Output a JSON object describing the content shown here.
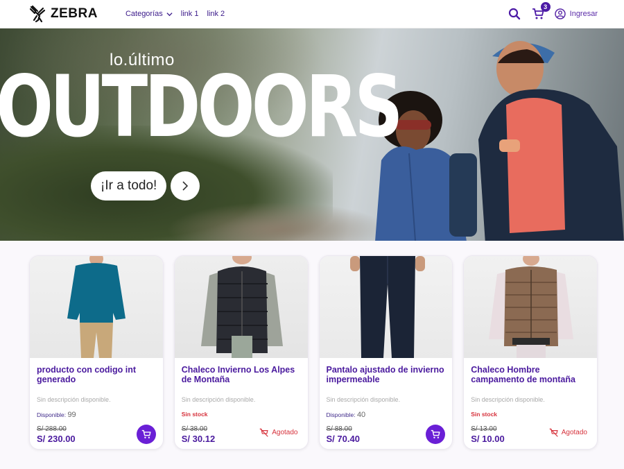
{
  "header": {
    "brand": "ZEBRA",
    "nav": [
      {
        "label": "Categorías",
        "has_dropdown": true
      },
      {
        "label": "link 1"
      },
      {
        "label": "link 2"
      }
    ],
    "cart_count": "3",
    "login_label": "Ingresar",
    "icons": [
      "zebra-logo",
      "search-icon",
      "cart-icon",
      "user-icon"
    ]
  },
  "hero": {
    "kicker": "lo.último",
    "title": "OUTDOORS",
    "cta_label": "¡Ir a todo!",
    "arrow_icon": "chevron-right-icon"
  },
  "products": [
    {
      "title": "producto con codigo int generado",
      "description": "Sin descripción disponible.",
      "stock_label": "Disponible:",
      "stock_value": "99",
      "available": true,
      "price_old": "S/ 288.00",
      "price_new": "S/ 230.00",
      "image": "man-teal-shirt-khaki-pants"
    },
    {
      "title": "Chaleco Invierno Los Alpes de Montaña",
      "description": "Sin descripción disponible.",
      "stock_label": "Sin stock",
      "available": false,
      "price_old": "S/ 38.00",
      "price_new": "S/ 30.12",
      "sold_out_label": "Agotado",
      "image": "man-black-puffer-vest"
    },
    {
      "title": "Pantalo ajustado de invierno impermeable",
      "description": "Sin descripción disponible.",
      "stock_label": "Disponible:",
      "stock_value": "40",
      "available": true,
      "price_old": "S/ 88.00",
      "price_new": "S/ 70.40",
      "image": "navy-winter-pants"
    },
    {
      "title": "Chaleco Hombre campamento de montaña",
      "description": "Sin descripción disponible.",
      "stock_label": "Sin stock",
      "available": false,
      "price_old": "S/ 13.00",
      "price_new": "S/ 10.00",
      "sold_out_label": "Agotado",
      "image": "man-brown-puffer-vest"
    }
  ],
  "colors": {
    "brand_purple": "#4a1a9e",
    "accent_purple": "#6a1fd6",
    "sold_out_red": "#d6313b"
  }
}
